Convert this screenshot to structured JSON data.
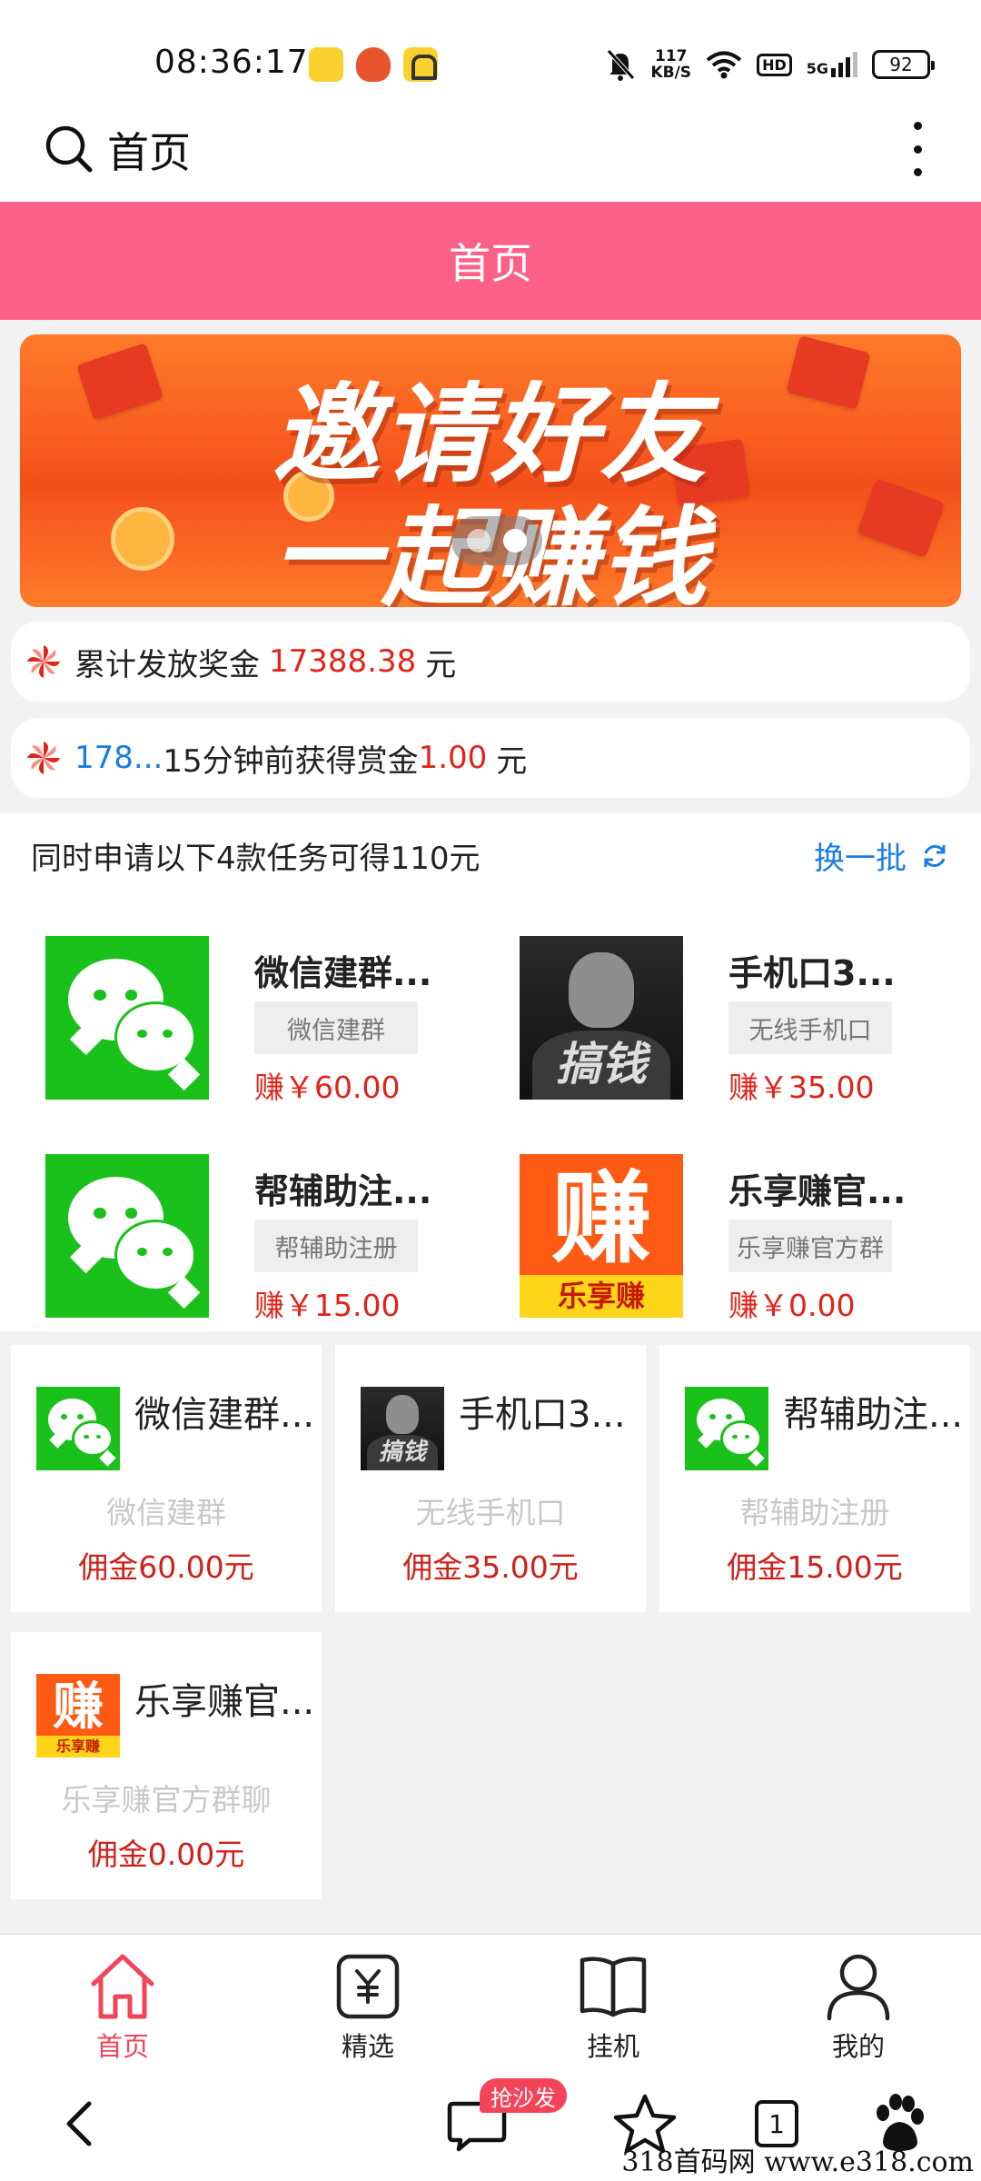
{
  "status_bar": {
    "time": "08:36:17",
    "net_speed_value": "117",
    "net_speed_unit": "KB/S",
    "hd": "HD",
    "network": "5G",
    "battery": "92"
  },
  "browser": {
    "title": "首页"
  },
  "page": {
    "header_title": "首页"
  },
  "banner": {
    "line1": "邀请好友",
    "line2": "一起赚钱"
  },
  "notices": {
    "total_prefix": "累计发放奖金",
    "total_amount": "17388.38",
    "total_unit": "元",
    "recent_user": "178...",
    "recent_text": "15分钟前获得赏金",
    "recent_amount": "1.00",
    "recent_unit": "元"
  },
  "task_section": {
    "title": "同时申请以下4款任务可得110元",
    "refresh_label": "换一批",
    "tasks": [
      {
        "name": "微信建群...",
        "tag": "微信建群",
        "earn": "赚￥60.00"
      },
      {
        "name": "手机口3...",
        "tag": "无线手机口",
        "earn": "赚￥35.00"
      },
      {
        "name": "帮辅助注...",
        "tag": "帮辅助注册",
        "earn": "赚￥15.00"
      },
      {
        "name": "乐享赚官...",
        "tag": "乐享赚官方群",
        "earn": "赚￥0.00"
      }
    ]
  },
  "grid": {
    "items": [
      {
        "name": "微信建群...",
        "subtitle": "微信建群",
        "commission": "佣金60.00元"
      },
      {
        "name": "手机口3...",
        "subtitle": "无线手机口",
        "commission": "佣金35.00元"
      },
      {
        "name": "帮辅助注...",
        "subtitle": "帮辅助注册",
        "commission": "佣金15.00元"
      },
      {
        "name": "乐享赚官...",
        "subtitle": "乐享赚官方群聊",
        "commission": "佣金0.00元"
      }
    ]
  },
  "icon_text": {
    "man": "搞钱",
    "zhuan": "赚",
    "zhuan_strip": "乐享赚"
  },
  "tabbar": {
    "tabs": [
      {
        "label": "首页",
        "icon": "home-icon",
        "active": true
      },
      {
        "label": "精选",
        "icon": "yen-icon",
        "active": false
      },
      {
        "label": "挂机",
        "icon": "book-icon",
        "active": false
      },
      {
        "label": "我的",
        "icon": "user-icon",
        "active": false
      }
    ]
  },
  "nav": {
    "badge": "抢沙发",
    "tabs_count": "1",
    "watermark": "318首码网  www.e318.com"
  },
  "colors": {
    "header_pink": "#fb6186",
    "accent_red": "#e2231a",
    "link_blue": "#1a7de0",
    "tab_active": "#f4445a",
    "wechat_green": "#1bc11b",
    "banner_orange": "#f4501a"
  }
}
